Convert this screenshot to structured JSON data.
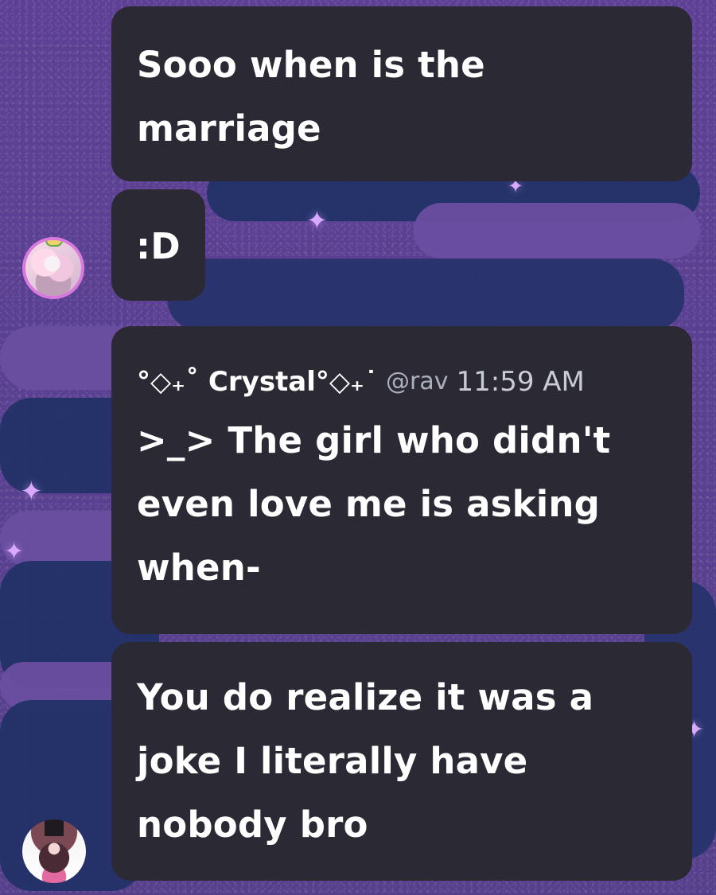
{
  "messages": [
    {
      "text": "Sooo when is the\nmarriage"
    },
    {
      "text": ":D"
    },
    {
      "author": "°◇₊˚ Crystal°◇₊˙",
      "handle": "@rav",
      "time": "11:59 AM",
      "text": ">_> The girl who didn't\neven love me is asking\nwhen-"
    },
    {
      "text": "You do realize it was a\njoke I literally have\nnobody bro"
    }
  ],
  "icons": {
    "sparkle": "✦"
  }
}
